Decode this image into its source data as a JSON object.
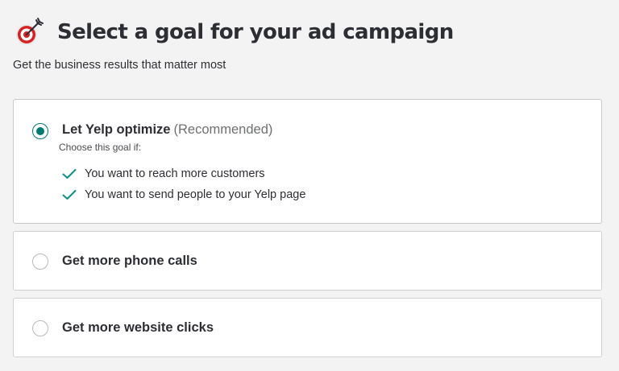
{
  "header": {
    "title": "Select a goal for your ad campaign",
    "subtitle": "Get the business results that matter most",
    "icon": "target-arrow-icon"
  },
  "options": [
    {
      "label": "Let Yelp optimize",
      "tag": "(Recommended)",
      "selected": true,
      "choose_label": "Choose this goal if:",
      "benefits": [
        "You want to reach more customers",
        "You want to send people to your Yelp page"
      ]
    },
    {
      "label": "Get more phone calls",
      "selected": false
    },
    {
      "label": "Get more website clicks",
      "selected": false
    }
  ],
  "colors": {
    "accent": "#027a74",
    "check": "#0d8f8a",
    "target_red": "#d32323",
    "background": "#f3f3f3"
  }
}
